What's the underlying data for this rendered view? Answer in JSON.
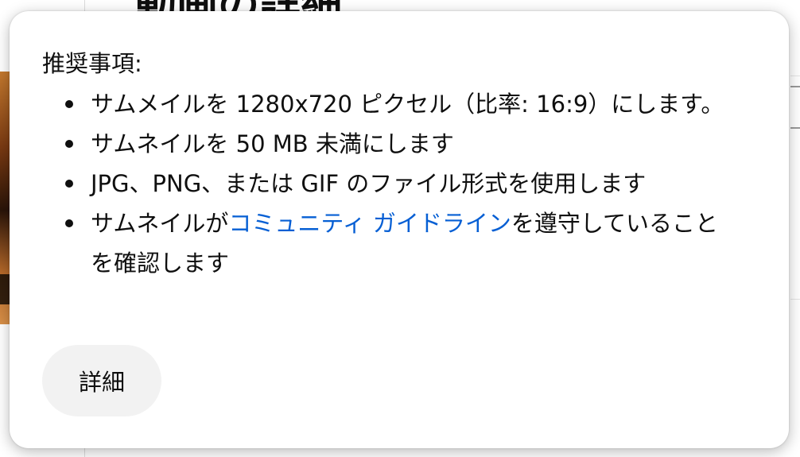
{
  "background": {
    "heading": "動画の詳細"
  },
  "dialog": {
    "title": "推奨事項:",
    "items": [
      {
        "text": "サムメイルを 1280x720 ピクセル（比率: 16:9）にします。"
      },
      {
        "text": "サムネイルを 50 MB 未満にします"
      },
      {
        "text": "JPG、PNG、または GIF のファイル形式を使用します"
      },
      {
        "prefix": "サムネイルが",
        "link": "コミュニティ ガイドライン",
        "suffix": "を遵守していることを確認します"
      }
    ],
    "details_button": "詳細"
  },
  "colors": {
    "link": "#065fd4",
    "text": "#0f0f0f",
    "button_bg": "#f2f2f2"
  }
}
